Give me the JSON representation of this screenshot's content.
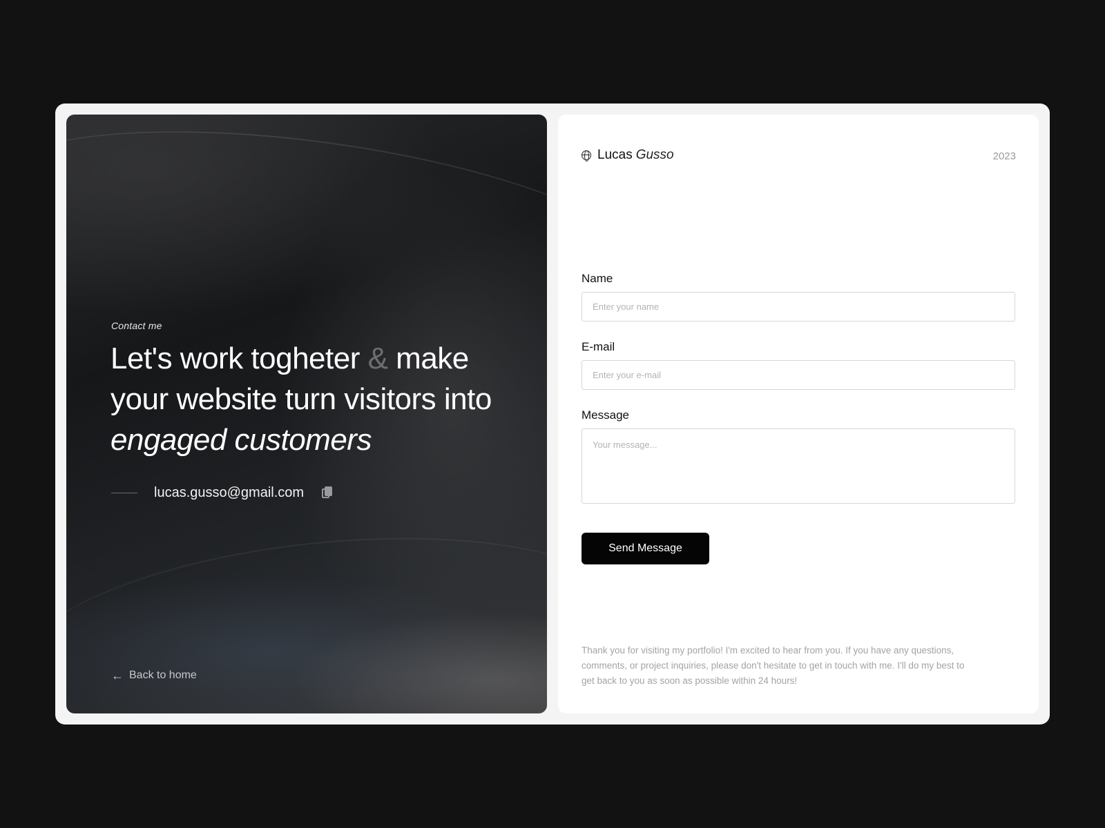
{
  "hero": {
    "kicker": "Contact me",
    "headline_part1": "Let's work togheter ",
    "headline_amp": "&",
    "headline_part2": " make your website turn visitors into ",
    "headline_italic": "engaged customers",
    "email": "lucas.gusso@gmail.com",
    "back_label": "Back to home",
    "icons": {
      "copy": "copy-icon",
      "back": "arrow-left-icon"
    }
  },
  "header": {
    "brand_first": "Lucas",
    "brand_last": "Gusso",
    "year": "2023",
    "logo_icon": "globe-icon"
  },
  "form": {
    "name": {
      "label": "Name",
      "placeholder": "Enter your name"
    },
    "email": {
      "label": "E-mail",
      "placeholder": "Enter your e-mail"
    },
    "message": {
      "label": "Message",
      "placeholder": "Your message..."
    },
    "submit_label": "Send Message"
  },
  "footer": {
    "note": "Thank you for visiting my portfolio! I'm excited to hear from you. If you have any questions, comments, or project inquiries, please don't hesitate to get in touch with me. I'll do my best to get back to you as soon as possible within 24 hours!"
  },
  "colors": {
    "page_background": "#121213",
    "frame": "#f4f4f4",
    "button": "#050505",
    "muted_text": "#a3a3a3"
  }
}
